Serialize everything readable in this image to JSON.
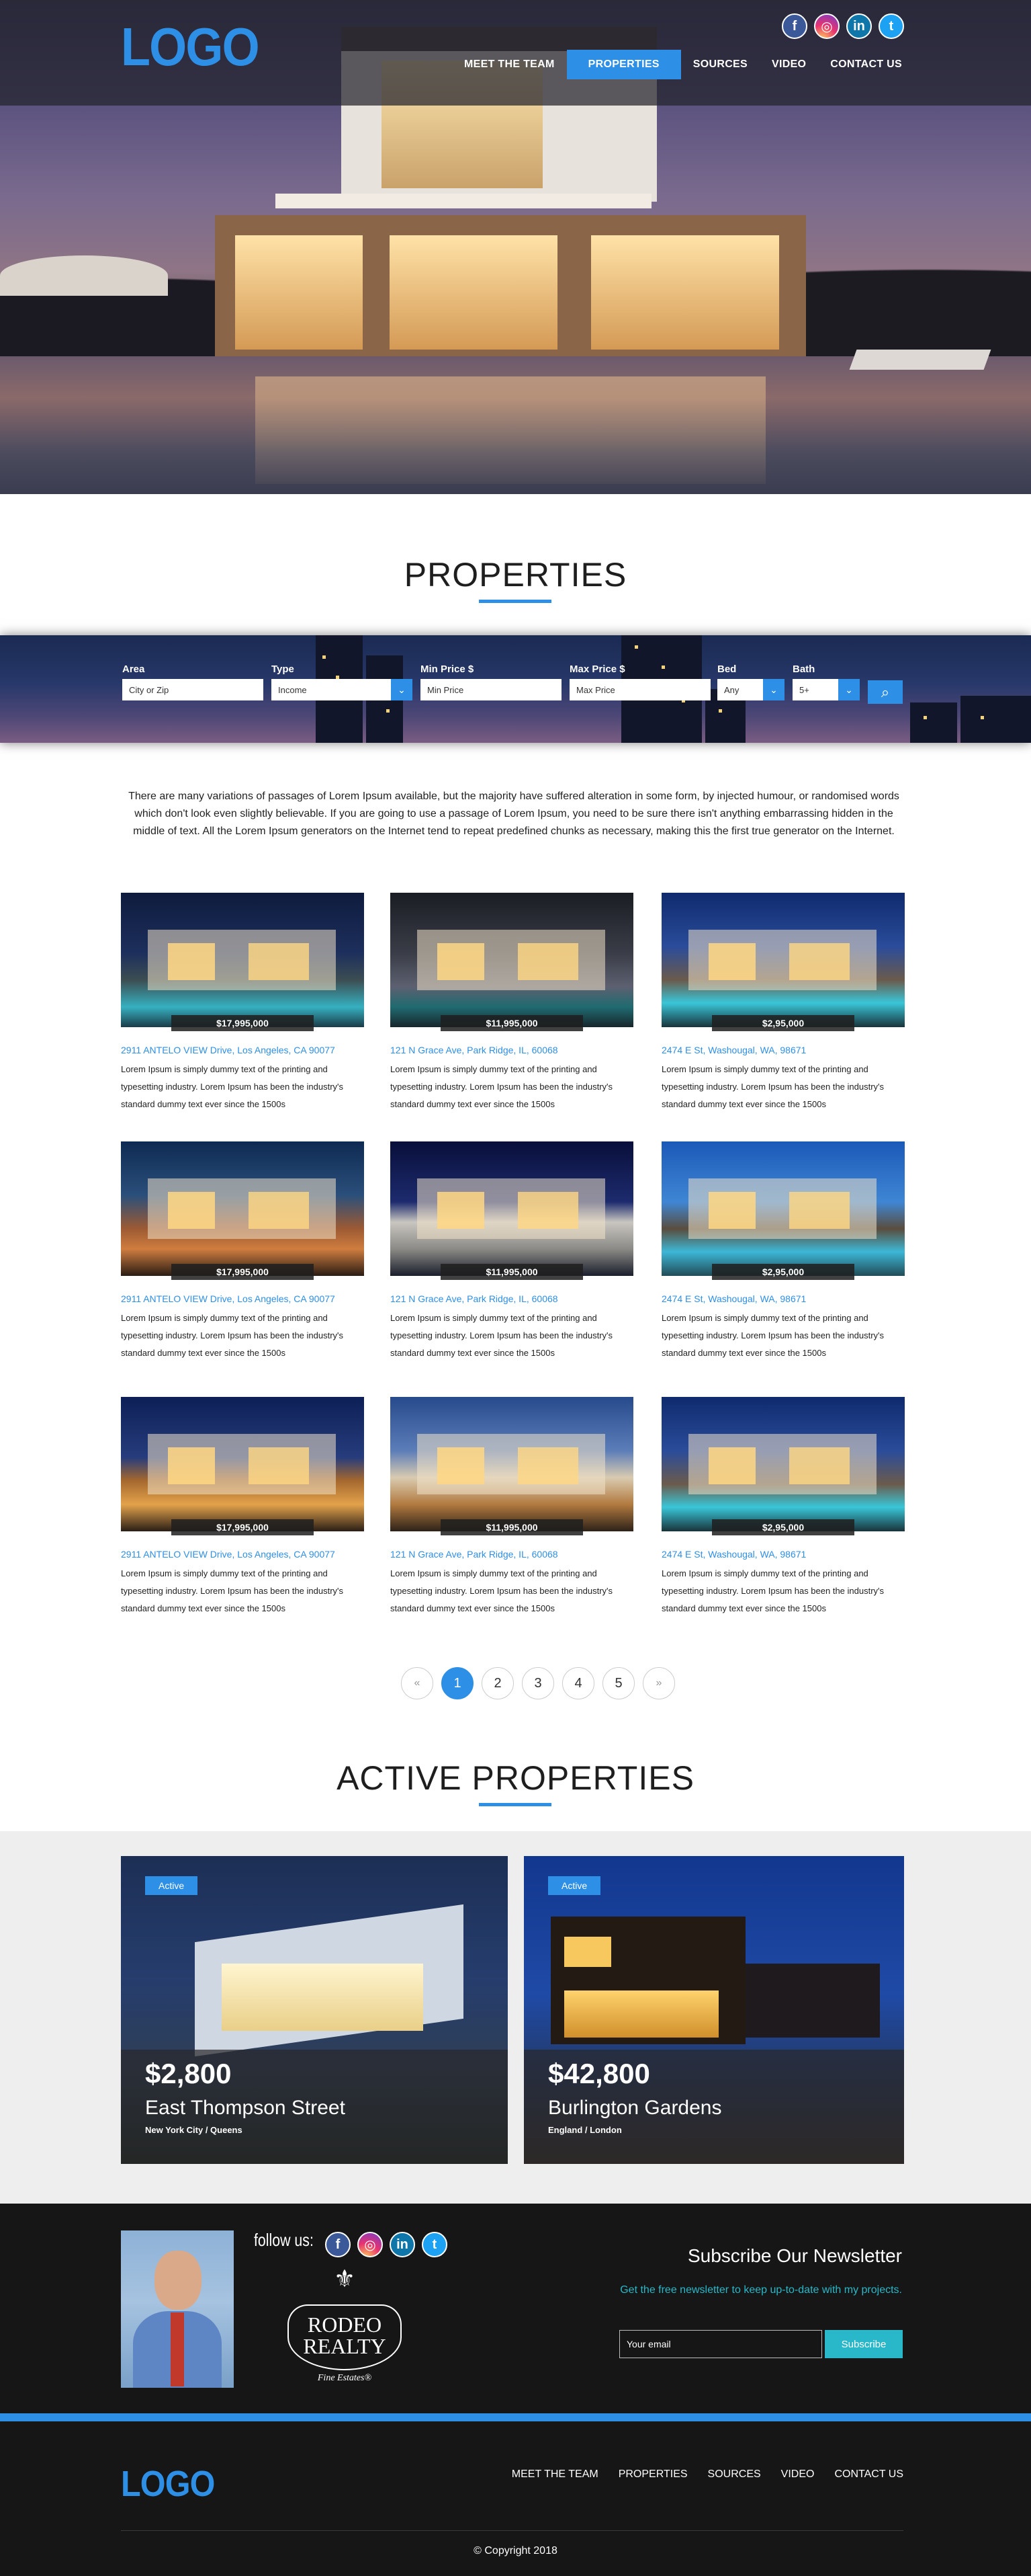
{
  "header": {
    "logo": "LOGO",
    "nav": [
      "MEET THE TEAM",
      "PROPERTIES",
      "SOURCES",
      "VIDEO",
      "CONTACT US"
    ],
    "active_nav": "PROPERTIES",
    "social": [
      {
        "icon": "facebook-icon",
        "glyph": "f"
      },
      {
        "icon": "instagram-icon",
        "glyph": "◎"
      },
      {
        "icon": "linkedin-icon",
        "glyph": "in"
      },
      {
        "icon": "twitter-icon",
        "glyph": "t"
      }
    ]
  },
  "properties": {
    "title": "PROPERTIES",
    "search": {
      "area_label": "Area",
      "area_placeholder": "City or Zip",
      "type_label": "Type",
      "type_value": "Income",
      "min_label": "Min Price $",
      "min_placeholder": "Min Price",
      "max_label": "Max Price $",
      "max_placeholder": "Max Price",
      "bed_label": "Bed",
      "bed_value": "Any",
      "bath_label": "Bath",
      "bath_value": "5+",
      "search_icon": "search-icon"
    },
    "intro": "There are many variations of passages of Lorem Ipsum available, but the majority have suffered alteration in some form, by injected humour, or randomised words which don't look even slightly believable. If you are going to use a passage of Lorem Ipsum, you need to be sure there isn't anything embarrassing hidden in the middle of text. All the Lorem Ipsum generators on the Internet tend to repeat predefined chunks as necessary, making this the first true generator on the Internet.",
    "listings": [
      {
        "price": "$17,995,000",
        "address": "2911 ANTELO VIEW Drive, Los Angeles, CA 90077",
        "desc": "Lorem Ipsum is simply dummy text of the printing and typesetting industry. Lorem Ipsum has been the industry's standard dummy text ever since the 1500s"
      },
      {
        "price": "$11,995,000",
        "address": "121 N Grace Ave, Park Ridge, IL, 60068",
        "desc": "Lorem Ipsum is simply dummy text of the printing and typesetting industry. Lorem Ipsum has been the industry's standard dummy text ever since the 1500s"
      },
      {
        "price": "$2,95,000",
        "address": "2474 E St, Washougal, WA, 98671",
        "desc": "Lorem Ipsum is simply dummy text of the printing and typesetting industry. Lorem Ipsum has been the industry's standard dummy text ever since the 1500s"
      },
      {
        "price": "$17,995,000",
        "address": "2911 ANTELO VIEW Drive, Los Angeles, CA 90077",
        "desc": "Lorem Ipsum is simply dummy text of the printing and typesetting industry. Lorem Ipsum has been the industry's standard dummy text ever since the 1500s"
      },
      {
        "price": "$11,995,000",
        "address": "121 N Grace Ave, Park Ridge, IL, 60068",
        "desc": "Lorem Ipsum is simply dummy text of the printing and typesetting industry. Lorem Ipsum has been the industry's standard dummy text ever since the 1500s"
      },
      {
        "price": "$2,95,000",
        "address": "2474 E St, Washougal, WA, 98671",
        "desc": "Lorem Ipsum is simply dummy text of the printing and typesetting industry. Lorem Ipsum has been the industry's standard dummy text ever since the 1500s"
      },
      {
        "price": "$17,995,000",
        "address": "2911 ANTELO VIEW Drive, Los Angeles, CA 90077",
        "desc": "Lorem Ipsum is simply dummy text of the printing and typesetting industry. Lorem Ipsum has been the industry's standard dummy text ever since the 1500s"
      },
      {
        "price": "$11,995,000",
        "address": "121 N Grace Ave, Park Ridge, IL, 60068",
        "desc": "Lorem Ipsum is simply dummy text of the printing and typesetting industry. Lorem Ipsum has been the industry's standard dummy text ever since the 1500s"
      },
      {
        "price": "$2,95,000",
        "address": "2474 E St, Washougal, WA, 98671",
        "desc": "Lorem Ipsum is simply dummy text of the printing and typesetting industry. Lorem Ipsum has been the industry's standard dummy text ever since the 1500s"
      }
    ],
    "pagination": {
      "prev": "«",
      "pages": [
        "1",
        "2",
        "3",
        "4",
        "5"
      ],
      "current": "1",
      "next": "»"
    }
  },
  "active_properties": {
    "title": "ACTIVE PROPERTIES",
    "items": [
      {
        "tag": "Active",
        "price": "$2,800",
        "street": "East Thompson Street",
        "location": "New York City / Queens"
      },
      {
        "tag": "Active",
        "price": "$42,800",
        "street": "Burlington Gardens",
        "location": "England / London"
      }
    ]
  },
  "newsletter": {
    "follow_label": "follow us:",
    "brand_line1": "RODEO",
    "brand_line2": "REALTY",
    "brand_tagline": "Fine Estates®",
    "title": "Subscribe Our Newsletter",
    "subtitle": "Get the free newsletter to keep up-to-date with my projects.",
    "email_placeholder": "Your email",
    "button": "Subscribe"
  },
  "footer": {
    "logo": "LOGO",
    "nav": [
      "MEET THE TEAM",
      "PROPERTIES",
      "SOURCES",
      "VIDEO",
      "CONTACT US"
    ],
    "copyright": "© Copyright 2018"
  },
  "colors": {
    "accent": "#2d8fe6",
    "teal": "#28b8c9",
    "footer_bg": "#161616"
  }
}
